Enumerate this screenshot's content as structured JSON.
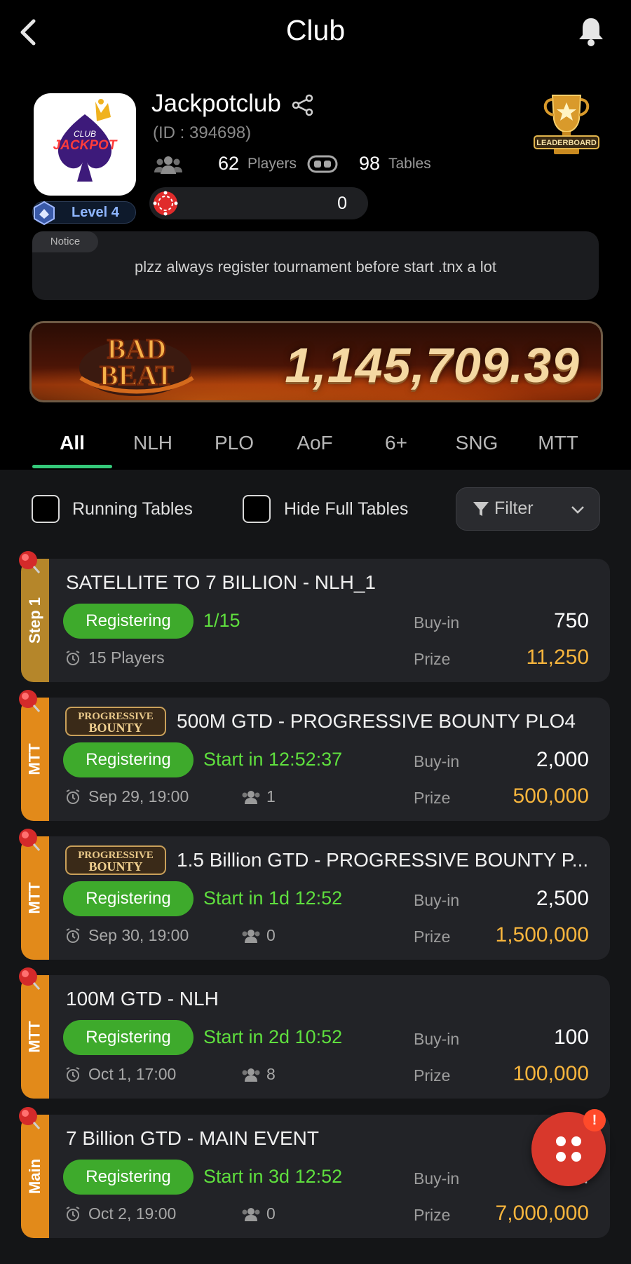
{
  "header": {
    "title": "Club"
  },
  "club": {
    "name": "Jackpotclub",
    "id_text": "(ID : 394698)",
    "logo_text_top": "CLUB",
    "logo_text_main": "JACKPOT",
    "level": "Level 4",
    "players_count": "62",
    "players_label": "Players",
    "tables_count": "98",
    "tables_label": "Tables",
    "chips": "0",
    "leaderboard_label": "LEADERBOARD"
  },
  "notice": {
    "tag": "Notice",
    "text": "plzz always register tournament before start .tnx a lot"
  },
  "banner": {
    "bad": "BAD",
    "beat": "BEAT",
    "amount": "1,145,709.39"
  },
  "tabs": [
    {
      "label": "All",
      "active": true
    },
    {
      "label": "NLH"
    },
    {
      "label": "PLO"
    },
    {
      "label": "AoF"
    },
    {
      "label": "6+"
    },
    {
      "label": "SNG"
    },
    {
      "label": "MTT"
    }
  ],
  "filters": {
    "running_tables": "Running Tables",
    "hide_full_tables": "Hide Full Tables",
    "filter_label": "Filter"
  },
  "buyin_label": "Buy-in",
  "prize_label": "Prize",
  "tournaments": [
    {
      "side": "Step 1",
      "side_color": "#b5862a",
      "title": "SATELLITE TO 7 BILLION - NLH_1",
      "bounty_logo": false,
      "status": "Registering",
      "info": "1/15",
      "date": "15 Players",
      "players": "",
      "buyin": "750",
      "prize": "11,250"
    },
    {
      "side": "MTT",
      "side_color": "#e28a1a",
      "title": "500M GTD - PROGRESSIVE BOUNTY PLO4",
      "bounty_logo": true,
      "status": "Registering",
      "info": "Start in 12:52:37",
      "date": "Sep 29, 19:00",
      "players": "1",
      "buyin": "2,000",
      "prize": "500,000"
    },
    {
      "side": "MTT",
      "side_color": "#e28a1a",
      "title": "1.5 Billion GTD - PROGRESSIVE BOUNTY P...",
      "bounty_logo": true,
      "status": "Registering",
      "info": "Start in 1d 12:52",
      "date": "Sep 30, 19:00",
      "players": "0",
      "buyin": "2,500",
      "prize": "1,500,000"
    },
    {
      "side": "MTT",
      "side_color": "#e28a1a",
      "title": "100M GTD - NLH",
      "bounty_logo": false,
      "status": "Registering",
      "info": "Start in 2d 10:52",
      "date": "Oct 1, 17:00",
      "players": "8",
      "buyin": "100",
      "prize": "100,000"
    },
    {
      "side": "Main",
      "side_color": "#e28a1a",
      "title": "7 Billion GTD - MAIN EVENT",
      "bounty_logo": false,
      "status": "Registering",
      "info": "Start in 3d 12:52",
      "date": "Oct 2, 19:00",
      "players": "0",
      "buyin": "4,...",
      "prize": "7,000,000"
    }
  ],
  "bounty_logo_text": [
    "PROGRESSIVE",
    "BOUNTY"
  ],
  "fab": {
    "alert": "!"
  },
  "colors": {
    "accent_green": "#35c97a",
    "status_green": "#3eaa2c",
    "prize_gold": "#f7b53d"
  }
}
